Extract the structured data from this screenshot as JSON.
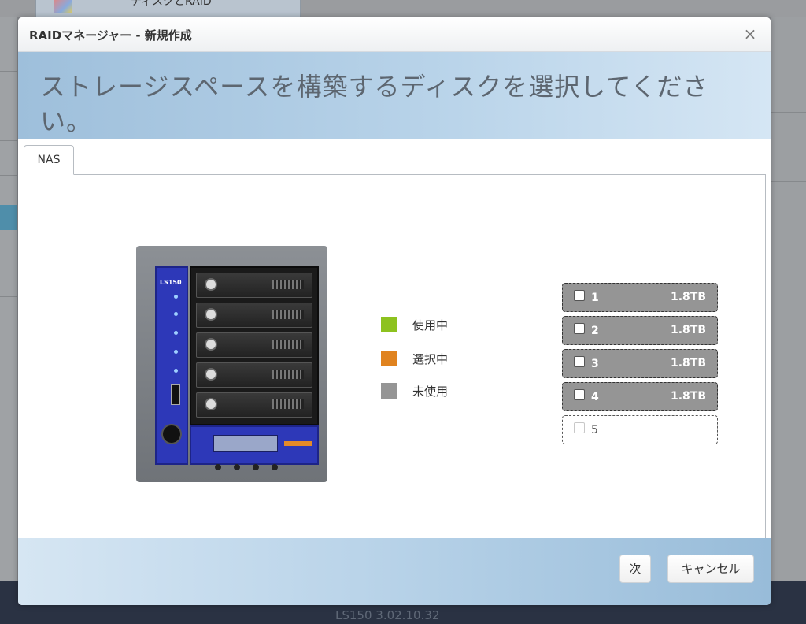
{
  "background": {
    "tab_label": "ディスクとRAID",
    "footer_version": "LS150   3.02.10.32"
  },
  "dialog": {
    "title": "RAIDマネージャー - 新規作成",
    "close_glyph": "×",
    "heading": "ストレージスペースを構築するディスクを選択してください。",
    "tab_label": "NAS"
  },
  "device": {
    "model_label": "LS150"
  },
  "legend": [
    {
      "label": "使用中",
      "color": "#8dc21f"
    },
    {
      "label": "選択中",
      "color": "#e0831f"
    },
    {
      "label": "未使用",
      "color": "#959595"
    }
  ],
  "disks": [
    {
      "number": "1",
      "size": "1.8TB",
      "present": true,
      "checked": false
    },
    {
      "number": "2",
      "size": "1.8TB",
      "present": true,
      "checked": false
    },
    {
      "number": "3",
      "size": "1.8TB",
      "present": true,
      "checked": false
    },
    {
      "number": "4",
      "size": "1.8TB",
      "present": true,
      "checked": false
    },
    {
      "number": "5",
      "size": "",
      "present": false,
      "checked": false
    }
  ],
  "buttons": {
    "next_label": "次",
    "cancel_label": "キャンセル"
  }
}
